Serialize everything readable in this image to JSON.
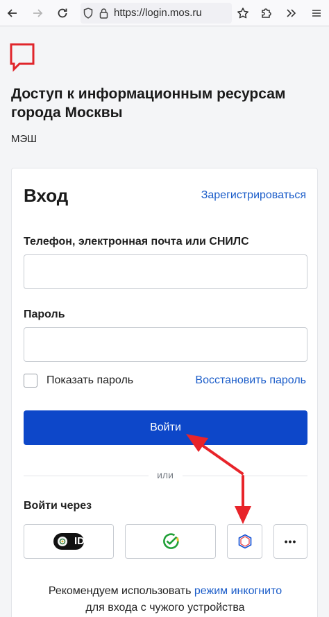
{
  "browser": {
    "url": "https://login.mos.ru"
  },
  "header": {
    "title": "Доступ к информационным ресурсам города Москвы",
    "system": "МЭШ"
  },
  "login": {
    "title": "Вход",
    "register_link": "Зарегистрироваться",
    "login_label": "Телефон, электронная почта или СНИЛС",
    "login_value": "",
    "password_label": "Пароль",
    "password_value": "",
    "show_password_label": "Показать пароль",
    "restore_link": "Восстановить пароль",
    "submit_label": "Войти",
    "or_text": "или",
    "login_via_label": "Войти через",
    "providers": [
      {
        "name": "id-provider",
        "label": "ID"
      },
      {
        "name": "sber-provider",
        "label": ""
      },
      {
        "name": "gosuslugi-provider",
        "label": ""
      },
      {
        "name": "more-providers",
        "label": "•••"
      }
    ],
    "recommend_text_1": "Рекомендуем использовать",
    "recommend_link": "режим инкогнито",
    "recommend_text_2": "для входа с чужого устройства"
  },
  "colors": {
    "accent": "#0d47c9",
    "link": "#1a5cc9",
    "logo_red": "#e0252b",
    "annotation_red": "#e8242a"
  }
}
